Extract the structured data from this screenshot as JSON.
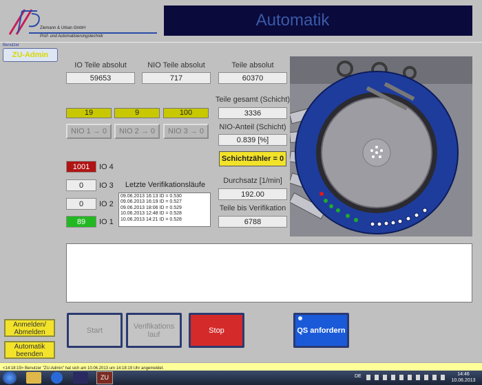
{
  "header": {
    "company_name": "Ziemann & Urban GmbH",
    "company_tagline": "Prüf- und Automatisierungstechnik",
    "logo_letters": "ZU",
    "title": "Automatik"
  },
  "user": {
    "group_label": "Benutzer",
    "button_label": "ZU-Admin"
  },
  "counters": {
    "io_label": "IO Teile absolut",
    "io_value": "59653",
    "nio_label": "NIO Teile absolut",
    "nio_value": "717",
    "total_label": "Teile absolut",
    "total_value": "60370"
  },
  "nio_counts": [
    "19",
    "9",
    "100"
  ],
  "nio_buttons": [
    "NIO 1 → 0",
    "NIO 2 → 0",
    "NIO 3 → 0"
  ],
  "shift": {
    "total_label": "Teile gesamt (Schicht)",
    "total_value": "3336",
    "nio_label": "NIO-Anteil (Schicht)",
    "nio_value": "0.839 [%]",
    "reset_button": "Schichtzähler = 0",
    "throughput_label": "Durchsatz [1/min]",
    "throughput_value": "192.00",
    "verif_label": "Teile bis Verifikation",
    "verif_value": "6788"
  },
  "io_levels": [
    {
      "value": "1001",
      "label": "IO 4",
      "color": "#b01414"
    },
    {
      "value": "0",
      "label": "IO 3",
      "color": "#ececec"
    },
    {
      "value": "0",
      "label": "IO 2",
      "color": "#ececec"
    },
    {
      "value": "89",
      "label": "IO 1",
      "color": "#22b822"
    }
  ],
  "verification": {
    "title": "Letzte Verifikationsläufe",
    "entries": [
      "09.06.2013 16:13 ID = 0.530",
      "09.06.2013 16:19 ID = 0.527",
      "09.06.2013 18:06 ID = 0.529",
      "10.06.2013 12:48 ID = 0.528",
      "10.06.2013 14:21 ID = 0.528"
    ]
  },
  "left_buttons": {
    "login": "Anmelden/ Abmelden",
    "end": "Automatik beenden"
  },
  "actions": {
    "start": "Start",
    "verification": "Verifikations lauf",
    "stop": "Stop",
    "qs": "QS anfordern"
  },
  "status_bar": {
    "message": "<14:18:19> Benutzer \"ZU-Admin\" hat sich am 10.06.2013 um 14:18:19 Uhr angemeldet."
  },
  "taskbar": {
    "language": "DE",
    "time": "14:46",
    "date": "10.06.2013"
  },
  "colors": {
    "title_bar": "#0a0a3c",
    "title_text": "#3a5aa8",
    "yellow": "#c8c800",
    "stop_red": "#d42a2a",
    "qs_blue": "#1a5ad8",
    "status_yellow": "#ffff99"
  }
}
